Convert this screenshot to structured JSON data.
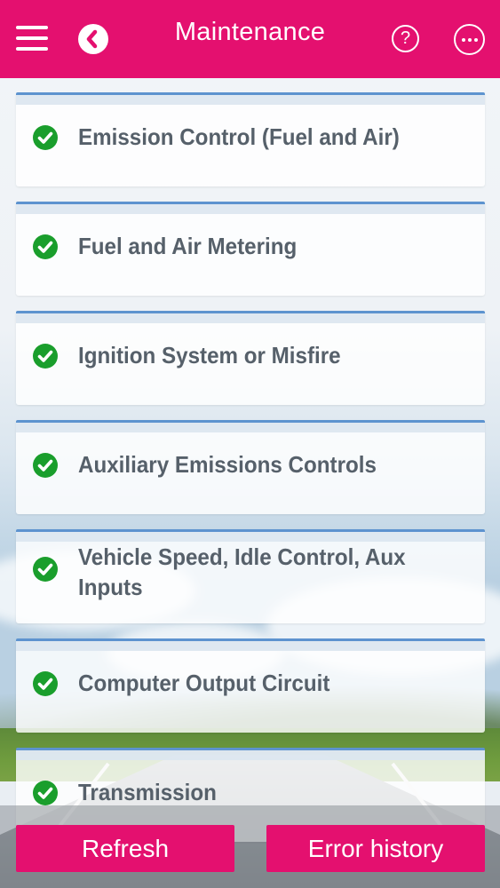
{
  "header": {
    "title": "Maintenance",
    "menu_icon": "hamburger-menu-icon",
    "back_icon": "back-chevron-icon",
    "help_icon": "help-question-icon",
    "help_glyph": "?",
    "more_icon": "more-ellipsis-icon",
    "color": "#e4106f"
  },
  "items": [
    {
      "label": "Emission Control (Fuel and Air)",
      "status": "ok"
    },
    {
      "label": "Fuel and Air Metering",
      "status": "ok"
    },
    {
      "label": "Ignition System or Misfire",
      "status": "ok"
    },
    {
      "label": "Auxiliary Emissions Controls",
      "status": "ok"
    },
    {
      "label": "Vehicle Speed, Idle Control, Aux Inputs",
      "status": "ok"
    },
    {
      "label": "Computer Output Circuit",
      "status": "ok"
    },
    {
      "label": "Transmission",
      "status": "ok"
    }
  ],
  "status_icon": "green-check-circle-icon",
  "status_color": "#1a9e2c",
  "footer": {
    "refresh_label": "Refresh",
    "history_label": "Error history"
  }
}
